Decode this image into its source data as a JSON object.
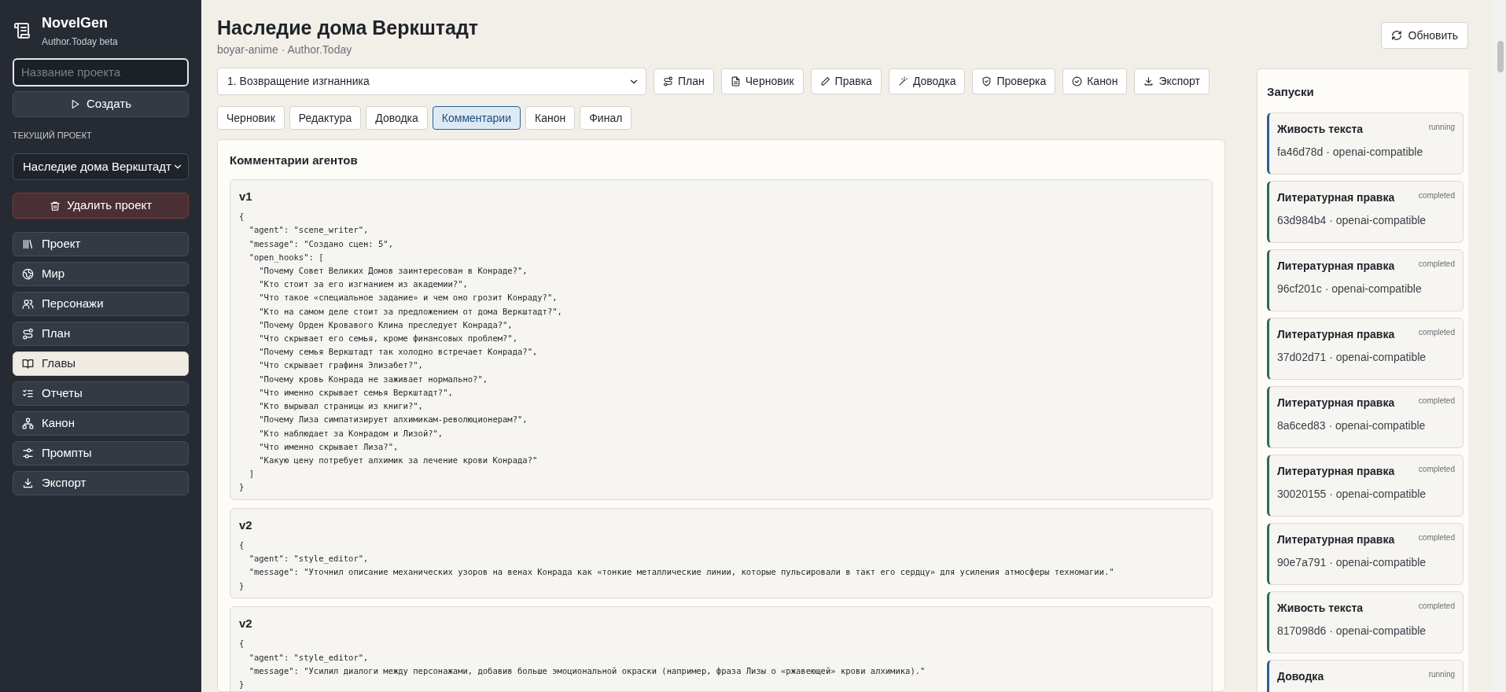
{
  "app": {
    "name": "NovelGen",
    "subtitle": "Author.Today beta"
  },
  "sidebar": {
    "project_name_field": {
      "placeholder": "Название проекта"
    },
    "create_button": "Создать",
    "current_project_label": "ТЕКУЩИЙ ПРОЕКТ",
    "current_project": "Наследие дома Веркштадт",
    "delete_button": "Удалить проект",
    "items": [
      {
        "label": "Проект",
        "selected": false
      },
      {
        "label": "Мир",
        "selected": false
      },
      {
        "label": "Персонажи",
        "selected": false
      },
      {
        "label": "План",
        "selected": false
      },
      {
        "label": "Главы",
        "selected": true
      },
      {
        "label": "Отчеты",
        "selected": false
      },
      {
        "label": "Канон",
        "selected": false
      },
      {
        "label": "Промпты",
        "selected": false
      },
      {
        "label": "Экспорт",
        "selected": false
      }
    ]
  },
  "header": {
    "title": "Наследие дома Веркштадт",
    "subtitle": "boyar-anime · Author.Today",
    "refresh_button": "Обновить"
  },
  "chapter_select": "1. Возвращение изгнанника",
  "actions": [
    "План",
    "Черновик",
    "Правка",
    "Доводка",
    "Проверка",
    "Канон",
    "Экспорт"
  ],
  "tabs": [
    {
      "label": "Черновик",
      "selected": false
    },
    {
      "label": "Редактура",
      "selected": false
    },
    {
      "label": "Доводка",
      "selected": false
    },
    {
      "label": "Комментарии",
      "selected": true
    },
    {
      "label": "Канон",
      "selected": false
    },
    {
      "label": "Финал",
      "selected": false
    }
  ],
  "comments": {
    "title": "Комментарии агентов",
    "items": [
      {
        "version": "v1",
        "body": "{\n  \"agent\": \"scene_writer\",\n  \"message\": \"Создано сцен: 5\",\n  \"open_hooks\": [\n    \"Почему Совет Великих Домов заинтересован в Конраде?\",\n    \"Кто стоит за его изгнанием из академии?\",\n    \"Что такое «специальное задание» и чем оно грозит Конраду?\",\n    \"Кто на самом деле стоит за предложением от дома Веркштадт?\",\n    \"Почему Орден Кровавого Клина преследует Конрада?\",\n    \"Что скрывает его семья, кроме финансовых проблем?\",\n    \"Почему семья Веркштадт так холодно встречает Конрада?\",\n    \"Что скрывает графиня Элизабет?\",\n    \"Почему кровь Конрада не заживает нормально?\",\n    \"Что именно скрывает семья Веркштадт?\",\n    \"Кто вырывал страницы из книги?\",\n    \"Почему Лиза симпатизирует алхимикам-революционерам?\",\n    \"Кто наблюдает за Конрадом и Лизой?\",\n    \"Что именно скрывает Лиза?\",\n    \"Какую цену потребует алхимик за лечение крови Конрада?\"\n  ]\n}"
      },
      {
        "version": "v2",
        "body": "{\n  \"agent\": \"style_editor\",\n  \"message\": \"Уточнил описание механических узоров на венах Конрада как «тонкие металлические линии, которые пульсировали в такт его сердцу» для усиления атмосферы техномагии.\"\n}"
      },
      {
        "version": "v2",
        "body": "{\n  \"agent\": \"style_editor\",\n  \"message\": \"Усилил диалоги между персонажами, добавив больше эмоциональной окраски (например, фраза Лизы о «ржавеющей» крови алхимика).\"\n}"
      }
    ]
  },
  "runs": {
    "title": "Запуски",
    "items": [
      {
        "name": "Живость текста",
        "status": "running",
        "meta": "fa46d78d · openai-compatible"
      },
      {
        "name": "Литературная правка",
        "status": "completed",
        "meta": "63d984b4 · openai-compatible"
      },
      {
        "name": "Литературная правка",
        "status": "completed",
        "meta": "96cf201c · openai-compatible"
      },
      {
        "name": "Литературная правка",
        "status": "completed",
        "meta": "37d02d71 · openai-compatible"
      },
      {
        "name": "Литературная правка",
        "status": "completed",
        "meta": "8a6ced83 · openai-compatible"
      },
      {
        "name": "Литературная правка",
        "status": "completed",
        "meta": "30020155 · openai-compatible"
      },
      {
        "name": "Литературная правка",
        "status": "completed",
        "meta": "90e7a791 · openai-compatible"
      },
      {
        "name": "Живость текста",
        "status": "completed",
        "meta": "817098d6 · openai-compatible"
      },
      {
        "name": "Доводка",
        "status": "running"
      }
    ]
  }
}
